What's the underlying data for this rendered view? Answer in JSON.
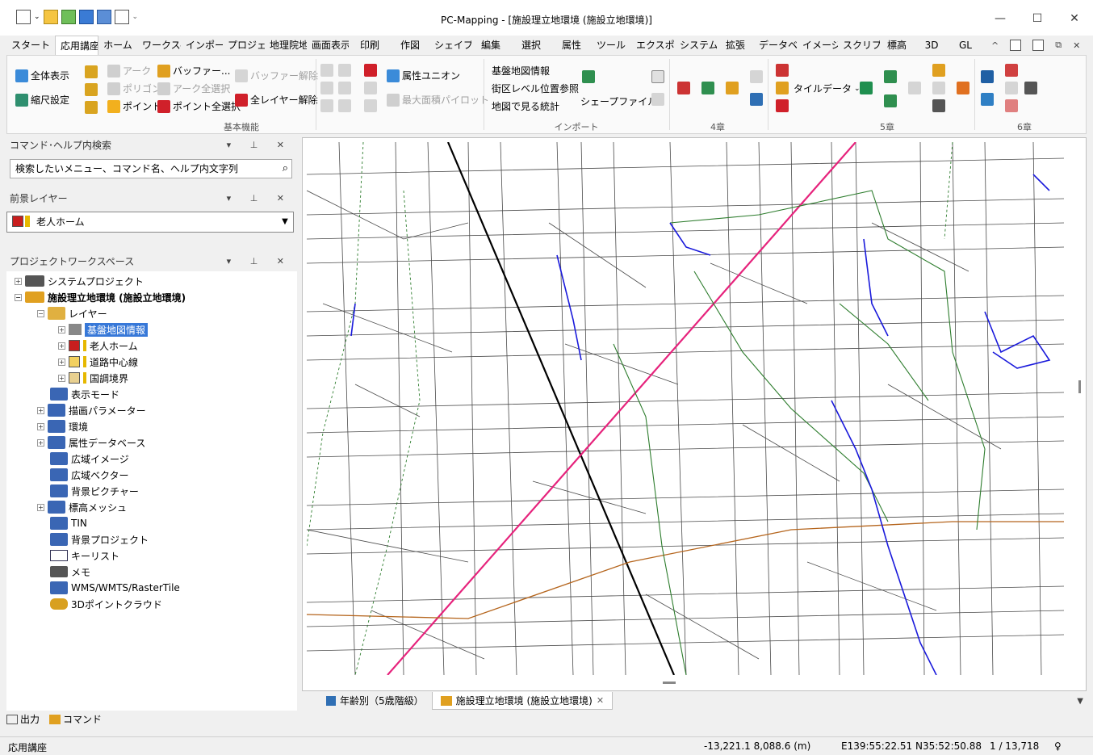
{
  "window": {
    "title": "PC-Mapping - [施設理立地環境 (施設立地環境)]"
  },
  "tabs": [
    "スタート",
    "応用講座",
    "ホーム",
    "ワークスペ",
    "インポート",
    "プロジェク",
    "地理院地",
    "画面表示",
    "印刷",
    "作図",
    "シェイプ",
    "編集",
    "選択",
    "属性",
    "ツール",
    "エクスポー",
    "システム",
    "拡張",
    "データベー",
    "イメージ",
    "スクリプト",
    "標高",
    "3D",
    "GL"
  ],
  "ribbon": {
    "basic": {
      "zenhyoji": "全体表示",
      "shukusho": "縮尺設定",
      "arc": "アーク",
      "polygon": "ポリゴン",
      "point": "ポイント",
      "buffer": "バッファー...",
      "arc_all": "アーク全選択",
      "point_all": "ポイント全選択",
      "buffer_release": "バッファー解除",
      "all_layer_release": "全レイヤー解除",
      "group_label": "基本機能"
    },
    "union": "属性ユニオン",
    "max_area": "最大面積パイロット",
    "import": {
      "kiban": "基盤地図情報",
      "gaiku": "街区レベル位置参照",
      "chizu": "地図で見る統計",
      "shape": "シェープファイル",
      "group_label": "インポート"
    },
    "ch4": "4章",
    "tile": "タイルデータ",
    "ch5": "5章",
    "ch6": "6章"
  },
  "panels": {
    "cmd_search": {
      "title": "コマンド･ヘルプ内検索",
      "placeholder": "検索したいメニュー、コマンド名、ヘルプ内文字列"
    },
    "foreground": {
      "title": "前景レイヤー",
      "value": "老人ホーム"
    },
    "workspace": {
      "title": "プロジェクトワークスペース"
    }
  },
  "tree": {
    "system_project": "システムプロジェクト",
    "project": "施設理立地環境 (施設立地環境)",
    "layer": "レイヤー",
    "kiban": "基盤地図情報",
    "rojin": "老人ホーム",
    "doro": "道路中心線",
    "kokuchou": "国調境界",
    "hyoji": "表示モード",
    "byoga": "描画パラメーター",
    "kankyo": "環境",
    "zokusei_db": "属性データベース",
    "koiki_image": "広域イメージ",
    "koiki_vector": "広域ベクター",
    "haikei_pic": "背景ピクチャー",
    "hyoko_mesh": "標高メッシュ",
    "tin": "TIN",
    "haikei_project": "背景プロジェクト",
    "keylist": "キーリスト",
    "memo": "メモ",
    "wms": "WMS/WMTS/RasterTile",
    "pointcloud": "3Dポイントクラウド"
  },
  "doc_tabs": {
    "tab1": "年齢別（5歳階級）",
    "tab2": "施設理立地環境 (施設立地環境)"
  },
  "bottom_tabs": {
    "output": "出力",
    "command": "コマンド"
  },
  "status": {
    "label": "応用講座",
    "xy": "-13,221.1 8,088.6 (m)",
    "latlon": "E139:55:22.51 N35:52:50.88",
    "page": "1 / 13,718"
  },
  "colors": {
    "rail": "#000000",
    "main_road": "#e6237c",
    "admin": "#2e7d2e",
    "river": "#1a1adb",
    "boundary": "#b5651d"
  }
}
